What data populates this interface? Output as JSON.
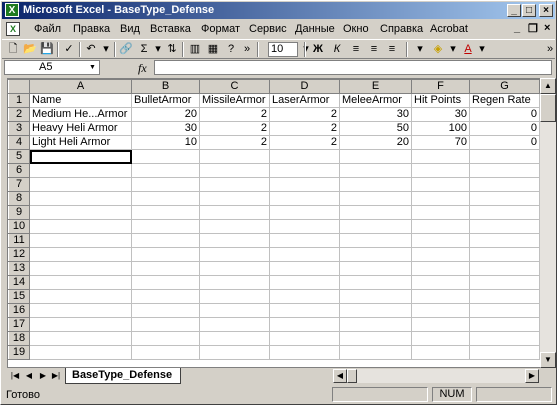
{
  "window": {
    "title": "Microsoft Excel - BaseType_Defense",
    "minimize": "_",
    "maximize": "□",
    "close": "×"
  },
  "menu": {
    "items": [
      "Файл",
      "Правка",
      "Вид",
      "Вставка",
      "Формат",
      "Сервис",
      "Данные",
      "Окно",
      "Справка",
      "Acrobat"
    ],
    "doc_min": "_",
    "doc_restore": "❐",
    "doc_close": "×"
  },
  "toolbar": {
    "font_size": "10",
    "bold": "Ж",
    "italic": "К"
  },
  "formula_bar": {
    "name_box": "A5",
    "fx": "fx",
    "formula": ""
  },
  "grid": {
    "column_headers": [
      "A",
      "B",
      "C",
      "D",
      "E",
      "F",
      "G"
    ],
    "row_numbers": [
      "1",
      "2",
      "3",
      "4",
      "5",
      "6",
      "7",
      "8",
      "9",
      "10",
      "11",
      "12",
      "13",
      "14",
      "15",
      "16",
      "17",
      "18",
      "19"
    ],
    "rows": [
      [
        "Name",
        "BulletArmor",
        "MissileArmor",
        "LaserArmor",
        "MeleeArmor",
        "Hit Points",
        "Regen Rate"
      ],
      [
        "Medium He...Armor",
        "20",
        "2",
        "2",
        "30",
        "30",
        "0"
      ],
      [
        "Heavy Heli Armor",
        "30",
        "2",
        "2",
        "50",
        "100",
        "0"
      ],
      [
        "Light Heli Armor",
        "10",
        "2",
        "2",
        "20",
        "70",
        "0"
      ]
    ],
    "selected_cell": "A5"
  },
  "sheet_tabs": [
    "BaseType_Defense"
  ],
  "status": {
    "left": "Готово",
    "num": "NUM"
  }
}
